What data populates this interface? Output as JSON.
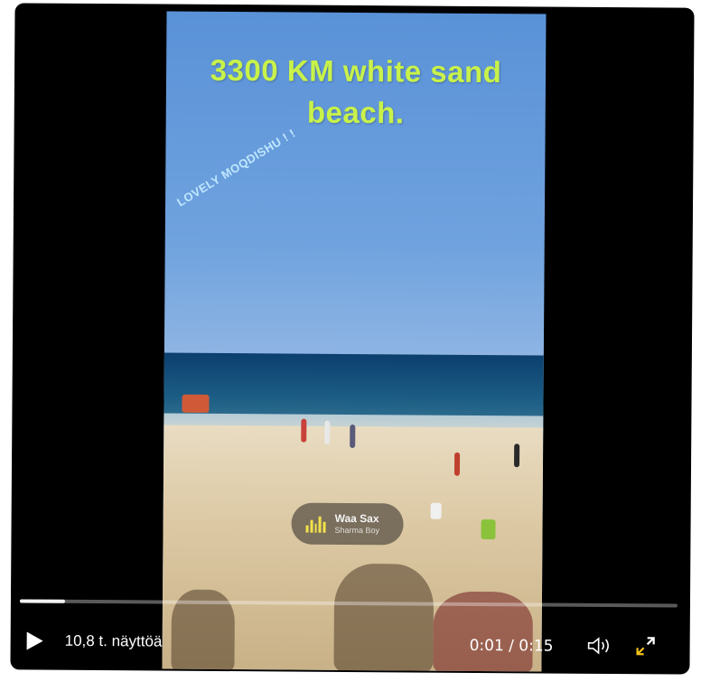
{
  "video": {
    "headline": "3300 KM white sand beach.",
    "sticker_text": "LOVELY MOQDISHU ! !",
    "music": {
      "title": "Waa Sax",
      "artist": "Sharma Boy",
      "icon": "sound-bars-icon"
    }
  },
  "player": {
    "views_label": "10,8 t. näyttöä",
    "time_label": "0:01 / 0:15",
    "progress_fraction": 0.068,
    "icons": {
      "play": "play-icon",
      "volume": "volume-icon",
      "fullscreen": "fullscreen-icon"
    },
    "colors": {
      "headline": "#c8f24a",
      "fullscreen_icon": "#f2c31b",
      "music_bars": "#f2e24a"
    }
  }
}
